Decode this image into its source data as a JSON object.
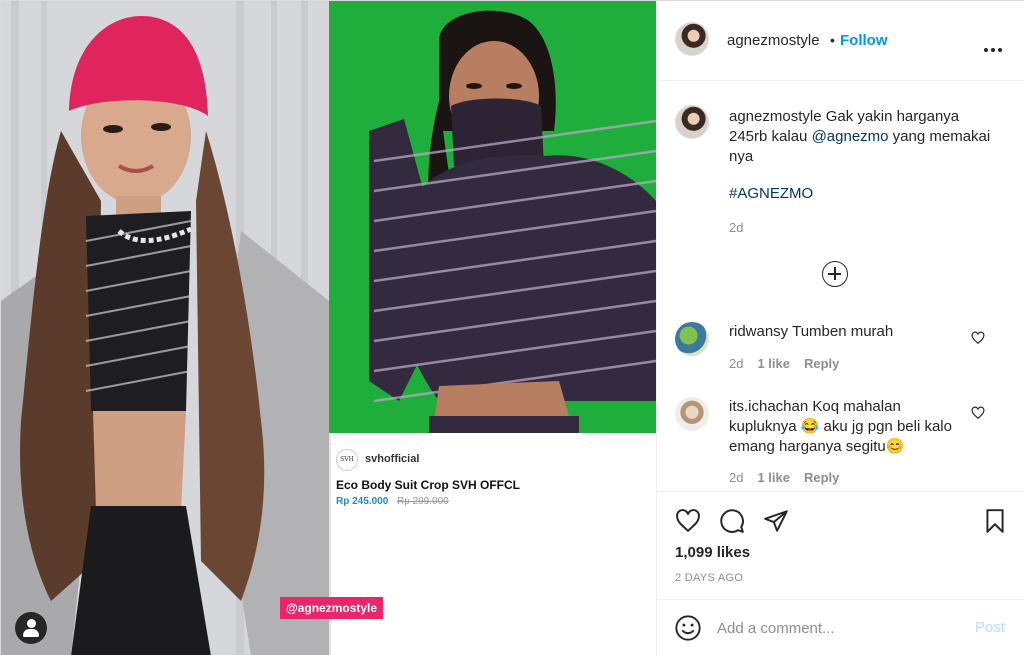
{
  "media": {
    "tag_label": "@agnezmostyle",
    "product": {
      "brand_logo_text": "SVH",
      "brand": "svhofficial",
      "name": "Eco Body Suit Crop SVH OFFCL",
      "price_now": "Rp 245.000",
      "price_old": "Rp 299.000"
    }
  },
  "header": {
    "username": "agnezmostyle",
    "dot": "•",
    "follow_label": "Follow"
  },
  "caption": {
    "username": "agnezmostyle",
    "text_before": " Gak yakin harganya 245rb kalau ",
    "mention": "@agnezmo",
    "text_after": " yang memakai nya",
    "hashtag": "#AGNEZMO",
    "time": "2d"
  },
  "comments": [
    {
      "username": "ridwansy",
      "text": " Tumben murah",
      "time": "2d",
      "likes": "1 like",
      "reply": "Reply"
    },
    {
      "username": "its.ichachan",
      "text": " Koq mahalan kupluknya 😂 aku jg pgn beli kalo emang harganya segitu😊",
      "time": "2d",
      "likes": "1 like",
      "reply": "Reply"
    }
  ],
  "footer": {
    "likes": "1,099 likes",
    "date": "2 DAYS AGO",
    "comment_placeholder": "Add a comment...",
    "post_label": "Post"
  },
  "colors": {
    "accent": "#0095f6",
    "tag": "#e8276b",
    "green_bg": "#1fae3c",
    "price": "#1c8ad8"
  },
  "icons": [
    "user-tag-icon",
    "more-icon",
    "plus-circle-icon",
    "heart-icon",
    "comment-icon",
    "share-icon",
    "bookmark-icon",
    "emoji-icon"
  ]
}
